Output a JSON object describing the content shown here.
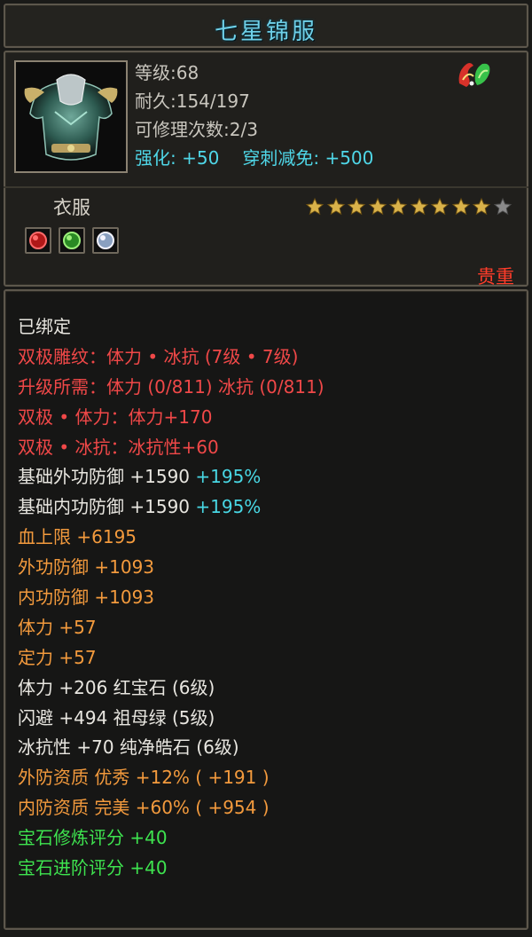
{
  "item": {
    "name": "七星锦服",
    "level_line": "等级:68",
    "durability_line": "耐久:154/197",
    "repair_line": "可修理次数:2/3",
    "enhance_label": "强化:",
    "enhance_value": "+50",
    "pierce_label": "穿刺减免:",
    "pierce_value": "+500",
    "type": "衣服",
    "quality": "贵重",
    "stars_filled": 9,
    "stars_total": 10,
    "gem_slots": [
      "red-gem-icon",
      "green-gem-icon",
      "white-gem-icon"
    ]
  },
  "stats": [
    {
      "parts": [
        {
          "text": "已绑定",
          "color": "white"
        }
      ]
    },
    {
      "parts": [
        {
          "text": "双极雕纹：体力 • 冰抗 (7级 • 7级)",
          "color": "red"
        }
      ]
    },
    {
      "parts": [
        {
          "text": "升级所需：体力 (0/811)  冰抗 (0/811)",
          "color": "red"
        }
      ]
    },
    {
      "parts": [
        {
          "text": "双极 • 体力：体力+170",
          "color": "red"
        }
      ]
    },
    {
      "parts": [
        {
          "text": "双极 • 冰抗：冰抗性+60",
          "color": "red"
        }
      ]
    },
    {
      "parts": [
        {
          "text": "基础外功防御 +1590 ",
          "color": "white"
        },
        {
          "text": "+195%",
          "color": "cyan"
        }
      ]
    },
    {
      "parts": [
        {
          "text": "基础内功防御 +1590 ",
          "color": "white"
        },
        {
          "text": "+195%",
          "color": "cyan"
        }
      ]
    },
    {
      "parts": [
        {
          "text": "血上限 +6195",
          "color": "orange"
        }
      ]
    },
    {
      "parts": [
        {
          "text": "外功防御 +1093",
          "color": "orange"
        }
      ]
    },
    {
      "parts": [
        {
          "text": "内功防御 +1093",
          "color": "orange"
        }
      ]
    },
    {
      "parts": [
        {
          "text": "体力 +57",
          "color": "orange"
        }
      ]
    },
    {
      "parts": [
        {
          "text": "定力 +57",
          "color": "orange"
        }
      ]
    },
    {
      "parts": [
        {
          "text": "体力 +206 红宝石 (6级)",
          "color": "white"
        }
      ]
    },
    {
      "parts": [
        {
          "text": "闪避 +494 祖母绿 (5级)",
          "color": "white"
        }
      ]
    },
    {
      "parts": [
        {
          "text": "冰抗性 +70 纯净皓石 (6级)",
          "color": "white"
        }
      ]
    },
    {
      "parts": [
        {
          "text": "外防资质  优秀 +12% ( +191 )",
          "color": "orange"
        }
      ]
    },
    {
      "parts": [
        {
          "text": "内防资质  完美 +60% ( +954 )",
          "color": "orange"
        }
      ]
    },
    {
      "parts": [
        {
          "text": "宝石修炼评分 +40",
          "color": "green"
        }
      ]
    },
    {
      "parts": [
        {
          "text": "宝石进阶评分 +40",
          "color": "green"
        }
      ]
    }
  ],
  "colors": {
    "white": "#e8e6e0",
    "red": "#f04848",
    "orange": "#f39a3d",
    "green": "#3ee34f",
    "cyan": "#48d7e4",
    "title": "#6fd0e8",
    "quality": "#ff3c2a"
  }
}
